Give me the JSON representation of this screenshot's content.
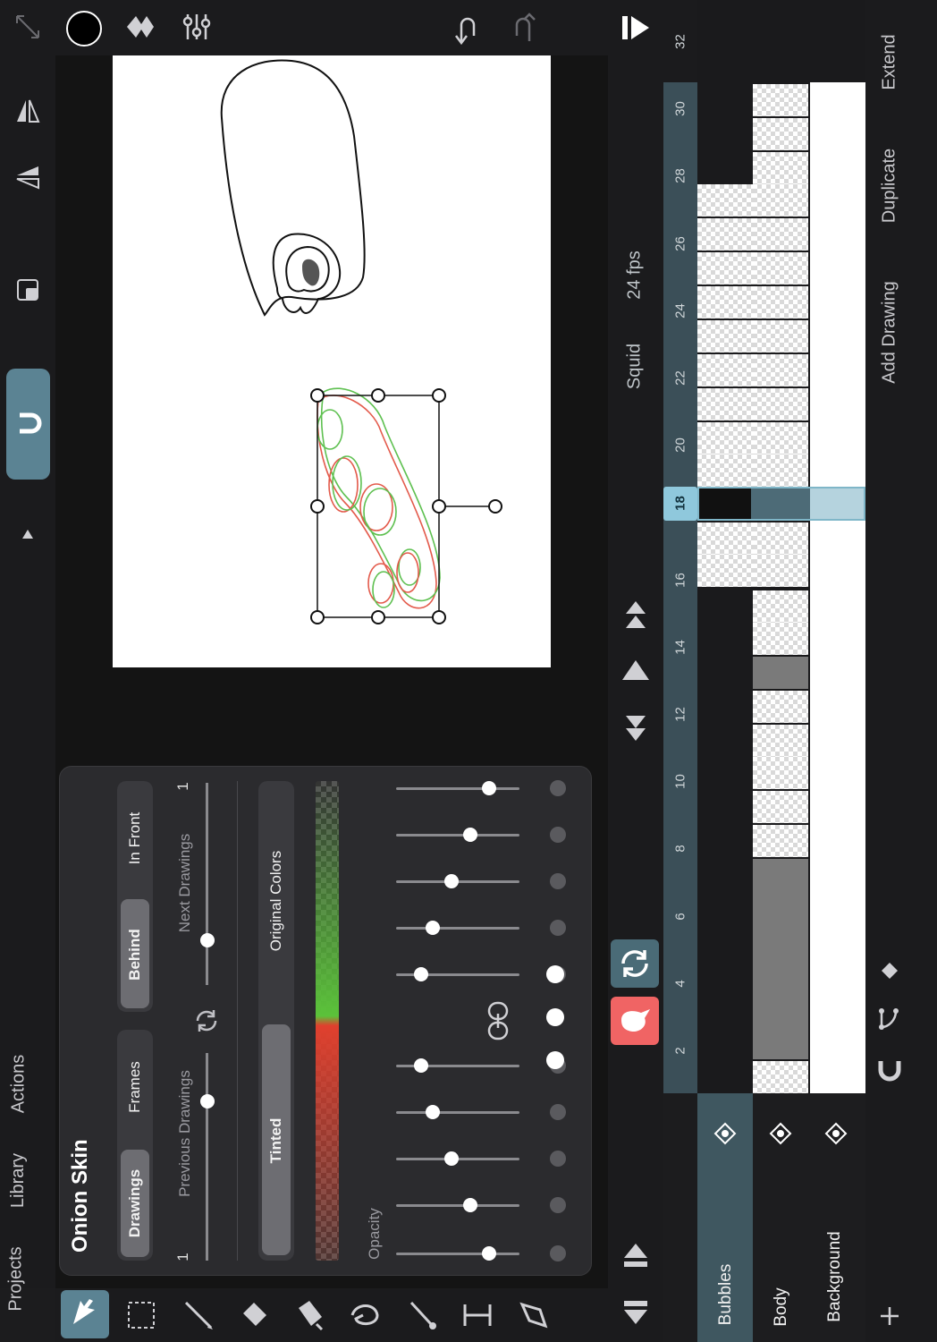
{
  "nav": {
    "projects": "Projects",
    "library": "Library",
    "actions": "Actions"
  },
  "brush_color": "#000000",
  "accent_color": "#5b8393",
  "onion_skin": {
    "title": "Onion Skin",
    "mode_options": [
      "Drawings",
      "Frames"
    ],
    "mode_selected": "Drawings",
    "position_options": [
      "Behind",
      "In Front"
    ],
    "position_selected": "Behind",
    "previous_label": "Previous Drawings",
    "previous_value": "1",
    "next_label": "Next Drawings",
    "next_value": "1",
    "color_options": [
      "Tinted",
      "Original Colors"
    ],
    "color_selected": "Tinted",
    "previous_tint": "#e0402e",
    "next_tint": "#5bc23a",
    "opacity_label": "Opacity",
    "previous_opacity_levels": [
      0.75,
      0.6,
      0.45,
      0.3,
      0.2
    ],
    "next_opacity_levels": [
      0.2,
      0.3,
      0.45,
      0.6,
      0.75
    ],
    "toggle_icon": "onion-icon"
  },
  "playback": {
    "project_name": "Squid",
    "fps": "24 fps"
  },
  "timeline": {
    "frame_numbers": [
      "2",
      "4",
      "6",
      "8",
      "10",
      "12",
      "14",
      "16",
      "18",
      "20",
      "22",
      "24",
      "26",
      "28",
      "30",
      "32"
    ],
    "current_frame": "18",
    "layers": [
      "Bubbles",
      "Body",
      "Background"
    ],
    "selected_layer": "Bubbles"
  },
  "actions": {
    "extend": "Extend",
    "duplicate": "Duplicate",
    "add_drawing": "Add Drawing"
  }
}
